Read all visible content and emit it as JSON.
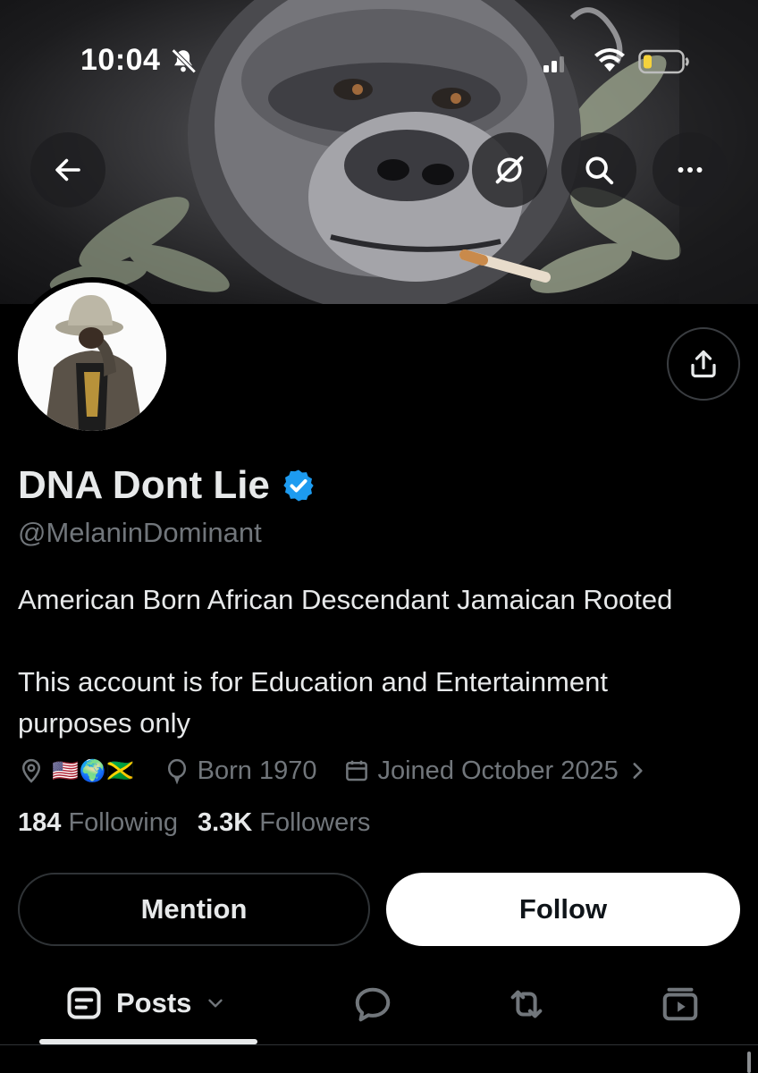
{
  "status_bar": {
    "time": "10:04",
    "icons": [
      "bell-slash-icon",
      "cellular-signal-icon",
      "wifi-icon",
      "battery-low-icon"
    ]
  },
  "header": {
    "icons": [
      "arrow-left-icon",
      "grok-icon",
      "search-icon",
      "more-horizontal-icon",
      "share-icon"
    ]
  },
  "profile": {
    "display_name": "DNA Dont Lie",
    "verified_icon": "verified-badge-icon",
    "handle": "@MelaninDominant",
    "bio_lines": [
      "American Born African Descendant Jamaican Rooted",
      "This account is for Education and Entertainment\npurposes only"
    ],
    "location_flags": "🇺🇸🌍🇯🇲",
    "birth": "Born 1970",
    "joined": "Joined October 2025",
    "following_count": "184",
    "following_label": "Following",
    "followers_count": "3.3K",
    "followers_label": "Followers"
  },
  "actions": {
    "mention_label": "Mention",
    "follow_label": "Follow"
  },
  "tabs": {
    "posts_label": "Posts",
    "icons": [
      "posts-icon",
      "chevron-down-icon",
      "replies-icon",
      "reposts-icon",
      "media-icon"
    ]
  },
  "colors": {
    "background": "#000000",
    "text_primary": "#e7e9ea",
    "text_secondary": "#71767b",
    "verified": "#1d9bf0",
    "border": "#2f3336",
    "battery_low": "#f5d33b"
  }
}
